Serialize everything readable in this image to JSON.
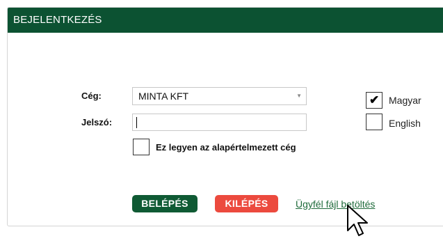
{
  "dialog": {
    "title": "BEJELENTKEZÉS"
  },
  "form": {
    "company_label": "Cég:",
    "company_value": "MINTA KFT",
    "password_label": "Jelszó:",
    "password_value": "",
    "default_company_label": "Ez legyen az alapértelmezett cég",
    "default_company_checked": false
  },
  "language": {
    "options": [
      {
        "label": "Magyar",
        "checked": true
      },
      {
        "label": "English",
        "checked": false
      }
    ]
  },
  "actions": {
    "login_label": "BELÉPÉS",
    "exit_label": "KILÉPÉS",
    "load_client_file_label": "Ügyfél fájl betöltés"
  },
  "colors": {
    "header": "#0c5232",
    "login_button": "#0f5a34",
    "exit_button": "#ec4a3e",
    "link": "#1f6b3b"
  },
  "icons": {
    "dropdown": "chevron-down-icon",
    "cursor": "mouse-pointer-icon",
    "check": "checkmark-icon"
  }
}
